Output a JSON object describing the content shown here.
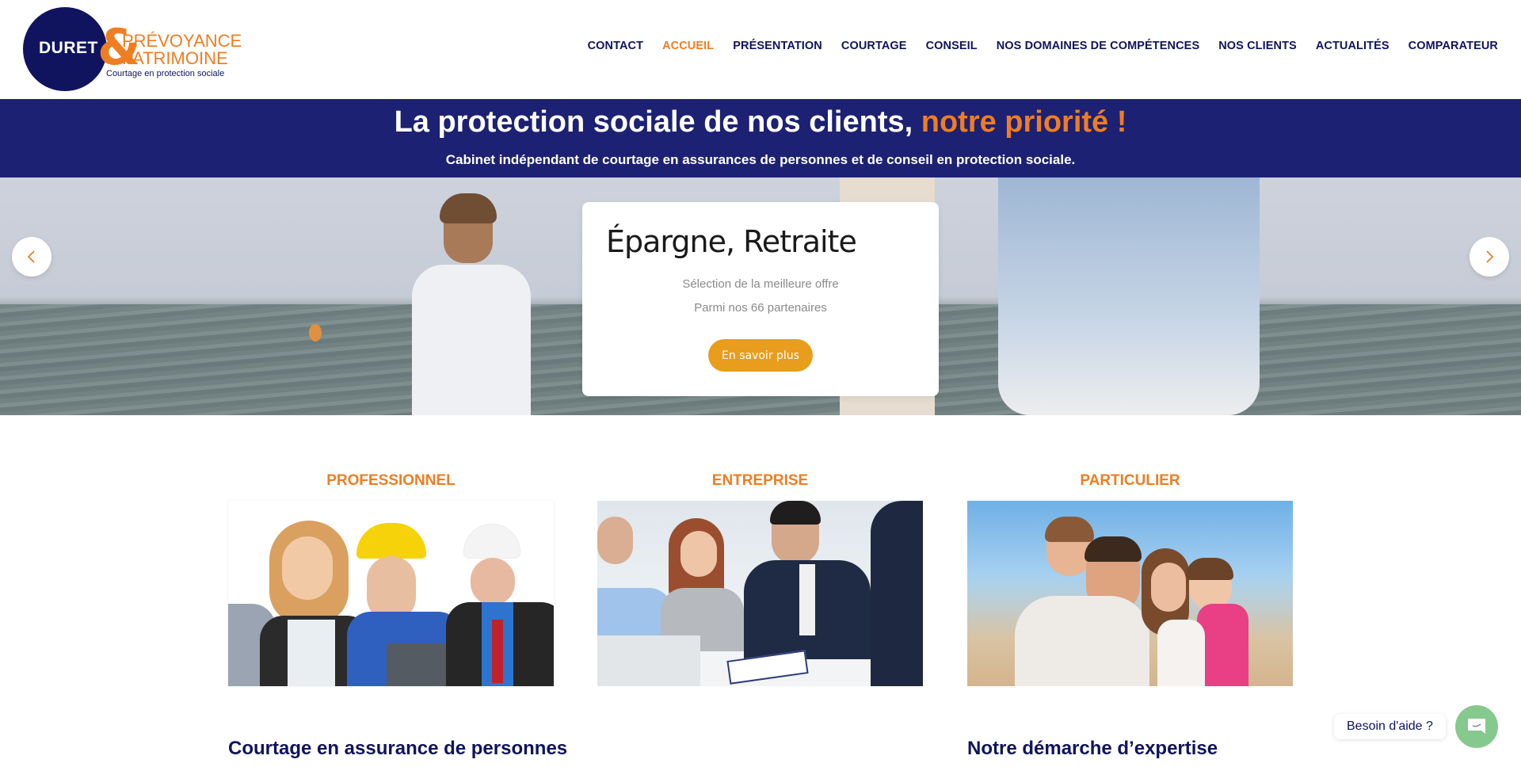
{
  "logo": {
    "name": "DURET",
    "ampersand": "&",
    "line1": "PRÉVOYANCE",
    "line2": "PATRIMOINE",
    "tagline": "Courtage en protection sociale"
  },
  "nav": {
    "items": [
      {
        "label": "CONTACT",
        "active": false
      },
      {
        "label": "ACCUEIL",
        "active": true
      },
      {
        "label": "PRÉSENTATION",
        "active": false
      },
      {
        "label": "COURTAGE",
        "active": false
      },
      {
        "label": "CONSEIL",
        "active": false
      },
      {
        "label": "NOS DOMAINES DE COMPÉTENCES",
        "active": false
      },
      {
        "label": "NOS CLIENTS",
        "active": false
      },
      {
        "label": "ACTUALITÉS",
        "active": false
      },
      {
        "label": "COMPARATEUR",
        "active": false
      }
    ]
  },
  "banner": {
    "title_main": "La protection sociale de nos clients, ",
    "title_accent": "notre priorité !",
    "subtitle": "Cabinet indépendant de courtage en assurances de personnes et de conseil en protection sociale."
  },
  "slider": {
    "prev_icon": "chevron-left-icon",
    "next_icon": "chevron-right-icon",
    "slide": {
      "title": "Épargne, Retraite",
      "line1": "Sélection de la meilleure offre",
      "line2": "Parmi nos 66 partenaires",
      "button": "En savoir plus"
    }
  },
  "categories": [
    {
      "title": "PROFESSIONNEL",
      "image": "professionals-group-photo"
    },
    {
      "title": "ENTREPRISE",
      "image": "business-meeting-photo"
    },
    {
      "title": "PARTICULIER",
      "image": "family-beach-photo"
    }
  ],
  "sections": {
    "left_heading": "Courtage en assurance de personnes",
    "right_heading": "Notre démarche d’expertise"
  },
  "help": {
    "label": "Besoin d'aide ?",
    "icon": "chat-icon"
  },
  "colors": {
    "navy": "#10145f",
    "orange": "#ef7d22",
    "button": "#e89d1d",
    "chat": "#86c98f"
  }
}
